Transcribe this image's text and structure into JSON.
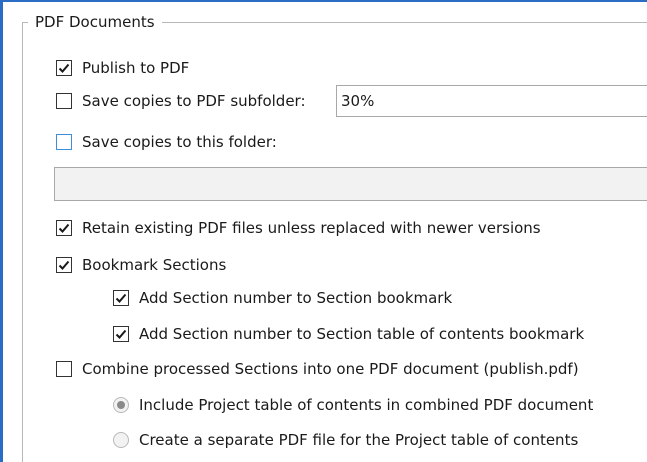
{
  "group": {
    "legend": "PDF Documents"
  },
  "options": {
    "publish_to_pdf": {
      "label": "Publish to PDF",
      "checked": true
    },
    "save_copies_subfolder": {
      "label": "Save copies to PDF subfolder:",
      "checked": false,
      "value": "30%"
    },
    "save_copies_folder": {
      "label": "Save copies to this folder:",
      "checked": false,
      "value": ""
    },
    "retain_existing": {
      "label": "Retain existing PDF files unless replaced with newer versions",
      "checked": true
    },
    "bookmark_sections": {
      "label": "Bookmark Sections",
      "checked": true
    },
    "add_section_number_bookmark": {
      "label": "Add Section number to Section bookmark",
      "checked": true
    },
    "add_section_number_toc": {
      "label": "Add Section number to Section table of contents bookmark",
      "checked": true
    },
    "combine_sections": {
      "label": "Combine processed Sections into one PDF document (publish.pdf)",
      "checked": false
    },
    "include_project_toc": {
      "label": "Include Project table of contents in combined PDF document",
      "selected": true,
      "enabled": false
    },
    "separate_toc_file": {
      "label": "Create a separate PDF file for the Project table of contents",
      "selected": false,
      "enabled": false
    }
  },
  "colors": {
    "frame_accent": "#2b6cc4",
    "focus_checkbox_border": "#3c8de0"
  }
}
